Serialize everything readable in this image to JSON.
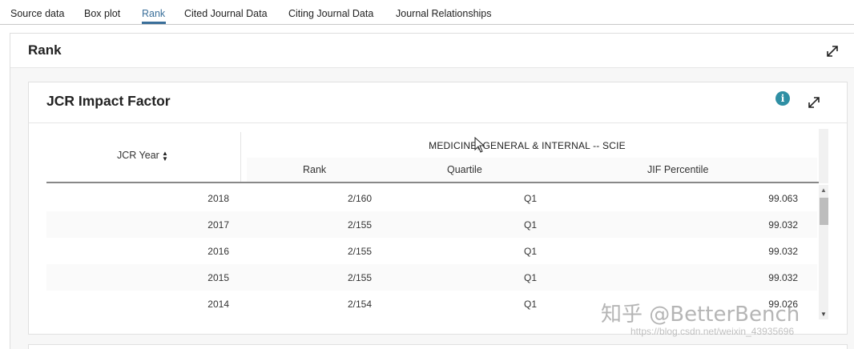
{
  "tabs": [
    {
      "label": "Source data"
    },
    {
      "label": "Box plot"
    },
    {
      "label": "Rank"
    },
    {
      "label": "Cited Journal Data"
    },
    {
      "label": "Citing Journal Data"
    },
    {
      "label": "Journal Relationships"
    }
  ],
  "active_tab": "Rank",
  "accent_color": "#3a6f9a",
  "section": {
    "title": "Rank"
  },
  "card": {
    "title": "JCR Impact Factor",
    "info_icon": "i",
    "table": {
      "year_header": "JCR Year",
      "group_header": "MEDICINE, GENERAL & INTERNAL -- SCIE",
      "columns": [
        "Rank",
        "Quartile",
        "JIF Percentile"
      ],
      "rows": [
        {
          "year": "2018",
          "rank": "2/160",
          "quartile": "Q1",
          "percentile": "99.063"
        },
        {
          "year": "2017",
          "rank": "2/155",
          "quartile": "Q1",
          "percentile": "99.032"
        },
        {
          "year": "2016",
          "rank": "2/155",
          "quartile": "Q1",
          "percentile": "99.032"
        },
        {
          "year": "2015",
          "rank": "2/155",
          "quartile": "Q1",
          "percentile": "99.032"
        },
        {
          "year": "2014",
          "rank": "2/154",
          "quartile": "Q1",
          "percentile": "99.026"
        }
      ]
    }
  },
  "watermark": {
    "text": "知乎 @BetterBench",
    "url": "https://blog.csdn.net/weixin_43935696"
  }
}
